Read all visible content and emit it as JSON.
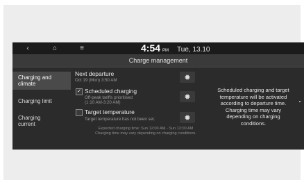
{
  "status_bar": {
    "back_glyph": "‹",
    "home_glyph": "⌂",
    "menu_glyph": "≡",
    "time": "4:54",
    "ampm": "PM",
    "date": "Tue, 13.10"
  },
  "title": "Charge management",
  "sidebar": {
    "items": [
      {
        "label_line1": "Charging and",
        "label_line2": "climate",
        "active": true
      },
      {
        "label_line1": "Charging limit",
        "label_line2": "",
        "active": false
      },
      {
        "label_line1": "Charging",
        "label_line2": "current",
        "active": false
      }
    ]
  },
  "main": {
    "next_departure": {
      "title": "Next departure",
      "sub": "Oct 19 (Mon) 3:50 AM"
    },
    "scheduled_charging": {
      "title": "Scheduled charging",
      "checked": true,
      "sub_line1": "Off-peak tariffs prioritised",
      "sub_line2": "(1:10 AM-3:20 AM)"
    },
    "target_temperature": {
      "title": "Target temperature",
      "checked": false,
      "sub": "Target temperature has not been set."
    },
    "gear_glyph": "✹",
    "footer_line1": "Expected charging time: Sun 12:00 AM - Sun 12:00 AM",
    "footer_line2": "Charging time may vary depending on charging conditions."
  },
  "info_panel": {
    "line1": "Scheduled charging and target",
    "line2": "temperature will be activated",
    "line3": "according to departure time.",
    "line4": "Charging time may vary",
    "line5": "depending on charging",
    "line6": "conditions."
  }
}
